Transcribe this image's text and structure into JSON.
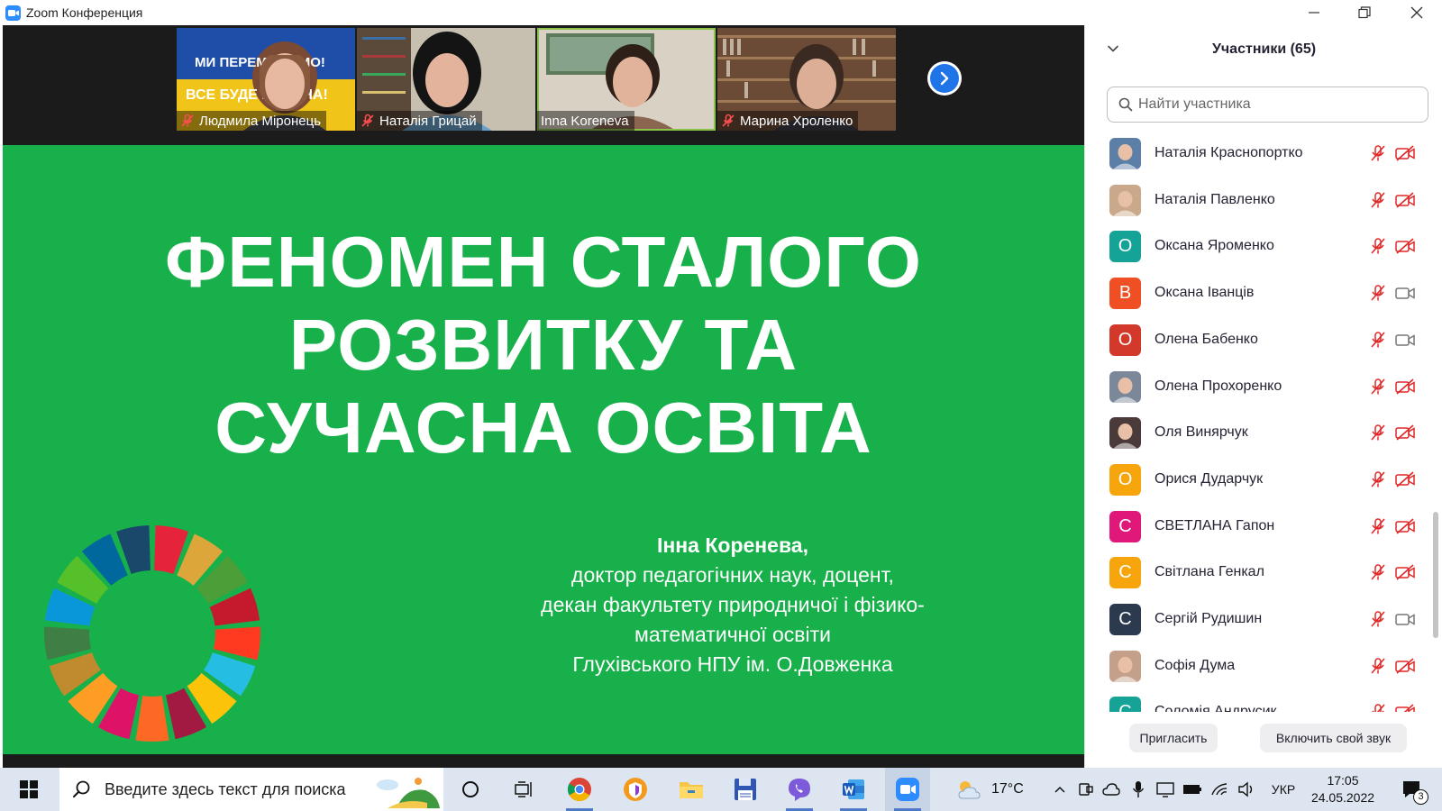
{
  "window": {
    "title": "Zoom Конференция"
  },
  "strip": {
    "tiles": [
      {
        "name": "Людмила Міронець",
        "muted": true,
        "banner_line1": "МИ ПЕРЕМОЖЕМО!",
        "banner_line2": "ВСЕ БУДЕ УКРАЇНА!"
      },
      {
        "name": "Наталія Грицай",
        "muted": true
      },
      {
        "name": "Inna Koreneva",
        "muted": false
      },
      {
        "name": "Марина Хроленко",
        "muted": true
      }
    ]
  },
  "slide": {
    "title_lines": [
      "ФЕНОМЕН СТАЛОГО",
      "РОЗВИТКУ ТА",
      "СУЧАСНА ОСВІТА"
    ],
    "author_name": "Інна Коренева,",
    "author_lines": [
      "доктор педагогічних наук, доцент,",
      "декан факультету природничої і фізико-",
      "математичної освіти",
      "Глухівського НПУ ім. О.Довженка"
    ]
  },
  "panel": {
    "title": "Участники (65)",
    "search_placeholder": "Найти участника",
    "participants": [
      {
        "name": "Наталія Краснопортко",
        "avatar_letter": "",
        "avatar_color": "#5b7fa6",
        "mic_muted": true,
        "cam_off": true
      },
      {
        "name": "Наталія Павленко",
        "avatar_letter": "",
        "avatar_color": "#c9a98a",
        "mic_muted": true,
        "cam_off": true
      },
      {
        "name": "Оксана  Яроменко",
        "avatar_letter": "О",
        "avatar_color": "#14A396",
        "mic_muted": true,
        "cam_off": true
      },
      {
        "name": "Оксана Іванців",
        "avatar_letter": "В",
        "avatar_color": "#F04E23",
        "mic_muted": true,
        "cam_off": false
      },
      {
        "name": "Олена Бабенко",
        "avatar_letter": "О",
        "avatar_color": "#D2392B",
        "mic_muted": true,
        "cam_off": false
      },
      {
        "name": "Олена Прохоренко",
        "avatar_letter": "",
        "avatar_color": "#7a8899",
        "mic_muted": true,
        "cam_off": true
      },
      {
        "name": "Оля Винярчук",
        "avatar_letter": "",
        "avatar_color": "#4a3a3a",
        "mic_muted": true,
        "cam_off": true
      },
      {
        "name": "Орися Дударчук",
        "avatar_letter": "О",
        "avatar_color": "#F6A60C",
        "mic_muted": true,
        "cam_off": true
      },
      {
        "name": "СВЕТЛАНА Гапон",
        "avatar_letter": "С",
        "avatar_color": "#E0187A",
        "mic_muted": true,
        "cam_off": true
      },
      {
        "name": "Світлана Генкал",
        "avatar_letter": "С",
        "avatar_color": "#F6A60C",
        "mic_muted": true,
        "cam_off": true
      },
      {
        "name": "Сергій Рудишин",
        "avatar_letter": "С",
        "avatar_color": "#2B3A4F",
        "mic_muted": true,
        "cam_off": false
      },
      {
        "name": "Софія Дума",
        "avatar_letter": "",
        "avatar_color": "#c4a08a",
        "mic_muted": true,
        "cam_off": true
      },
      {
        "name": "Соломія Андрусик",
        "avatar_letter": "С",
        "avatar_color": "#14A396",
        "mic_muted": true,
        "cam_off": true
      }
    ],
    "invite_label": "Пригласить",
    "unmute_label": "Включить свой звук"
  },
  "taskbar": {
    "search_placeholder": "Введите здесь текст для поиска",
    "weather": "17°C",
    "language": "УКР",
    "time": "17:05",
    "date": "24.05.2022",
    "notifications_count": "3"
  }
}
